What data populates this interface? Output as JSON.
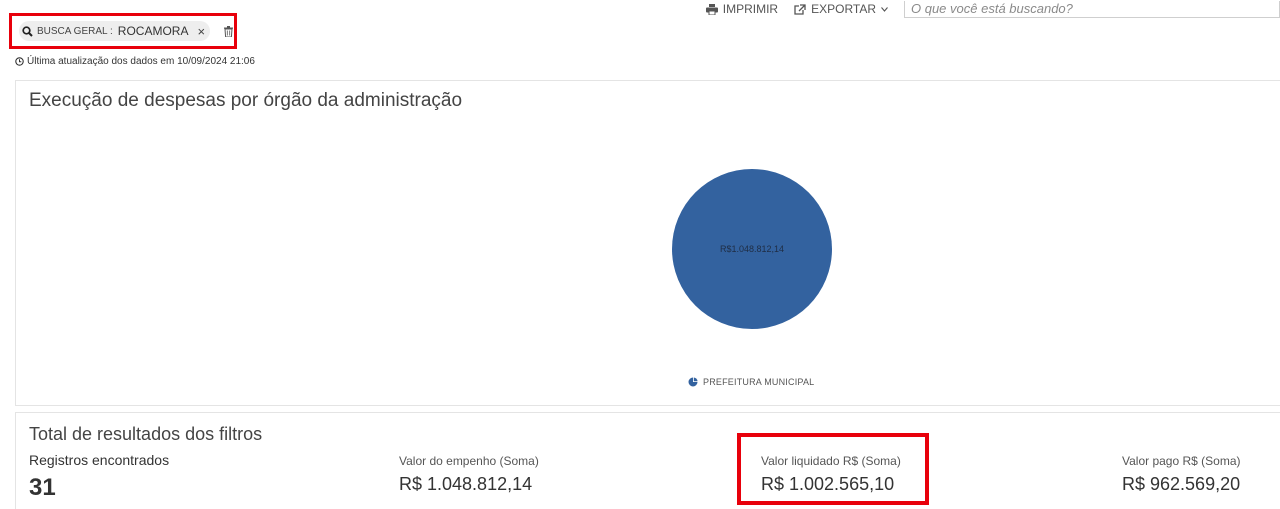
{
  "toolbar": {
    "print_label": "IMPRIMIR",
    "export_label": "EXPORTAR",
    "search_placeholder": "O que você está buscando?"
  },
  "filter": {
    "label": "BUSCA GERAL :",
    "value": "ROCAMORA"
  },
  "last_update": "Última atualização dos dados em 10/09/2024 21:06",
  "chart_panel": {
    "title": "Execução de despesas por órgão da administração"
  },
  "chart_data": {
    "type": "pie",
    "categories": [
      "PREFEITURA MUNICIPAL"
    ],
    "values": [
      1048812.14
    ],
    "data_labels": [
      "R$1.048.812,14"
    ],
    "colors": [
      "#33629f"
    ],
    "legend_position": "bottom"
  },
  "results_panel": {
    "title": "Total de resultados dos filtros",
    "stats": [
      {
        "label": "Registros encontrados",
        "value": "31"
      },
      {
        "label": "Valor do empenho (Soma)",
        "value": "R$ 1.048.812,14"
      },
      {
        "label": "Valor liquidado R$ (Soma)",
        "value": "R$ 1.002.565,10"
      },
      {
        "label": "Valor pago R$ (Soma)",
        "value": "R$ 962.569,20"
      }
    ]
  }
}
